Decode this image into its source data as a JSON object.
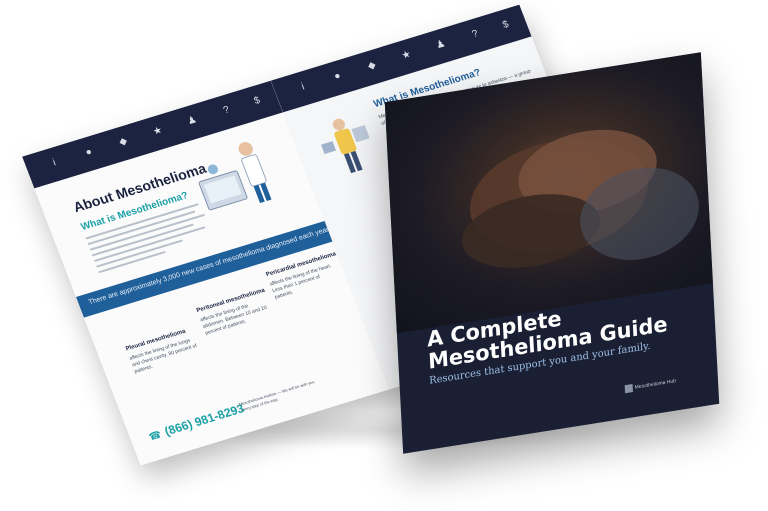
{
  "spread": {
    "left": {
      "heading": "About Mesothelioma",
      "subheading": "What is Mesothelioma?",
      "band_text": "There are approximately 3,000 new cases of mesothelioma diagnosed each year.",
      "columns": [
        {
          "title": "Pleural mesothelioma",
          "text": "affects the lining of the lungs and chest cavity. 80 percent of patients."
        },
        {
          "title": "Peritoneal mesothelioma",
          "text": "affects the lining of the abdomen. Between 10 and 20 percent of patients."
        },
        {
          "title": "Pericardial mesothelioma",
          "text": "affects the lining of the heart. Less than 1 percent of patients."
        }
      ],
      "phone": "(866) 981-8293",
      "phone_note": "Mesothelioma Hotline — We will be with you every step of the way."
    },
    "right": {
      "heading": "What is Mesothelioma?",
      "text": "Mesothelioma is most often caused by exposure to asbestos — a group of minerals that were widely used throughout the 20th century."
    }
  },
  "cover": {
    "title_line1": "A Complete",
    "title_line2": "Mesothelioma Guide",
    "subtitle": "Resources that support you and your family.",
    "brand": "Mesothelioma Hub"
  },
  "colors": {
    "navy": "#1c2340",
    "teal": "#1aa0a6",
    "blue_band": "#1f5f9a"
  }
}
